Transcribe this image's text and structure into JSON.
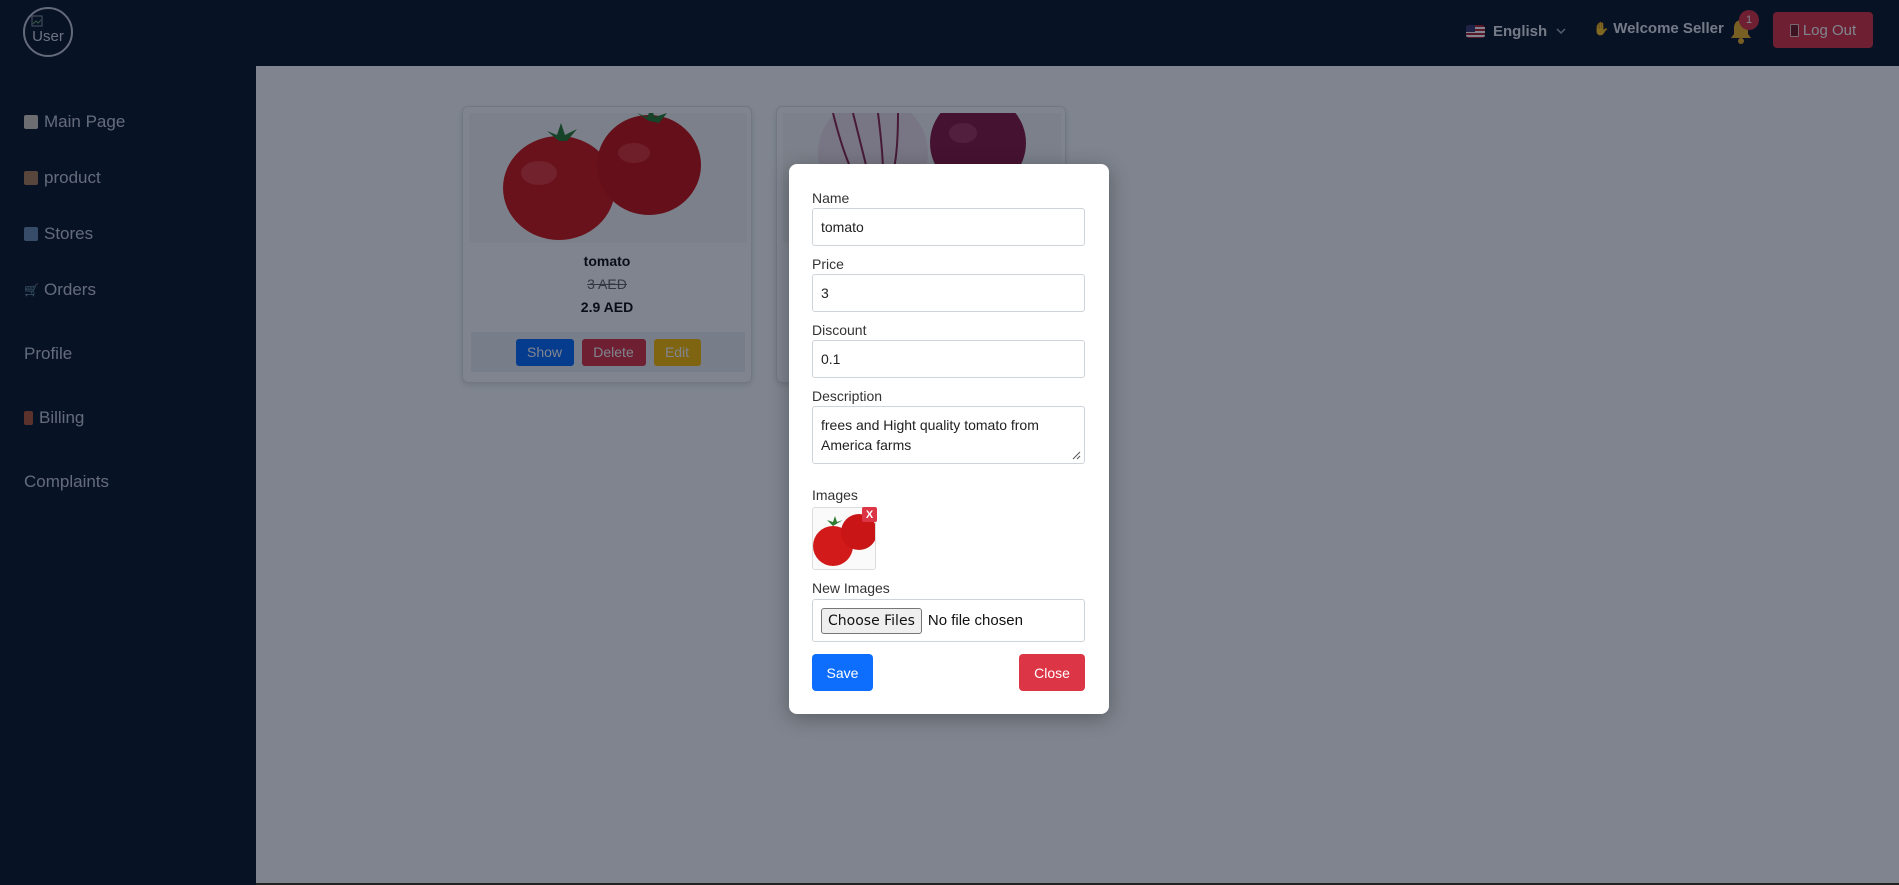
{
  "topbar": {
    "avatar_alt": "User",
    "language": "English",
    "welcome": "Welcome Seller",
    "notifications_count": "1",
    "logout_label": "Log Out",
    "icons": [
      "us-flag-icon",
      "chevron-down-icon",
      "waving-hand-icon",
      "bell-icon",
      "door-icon"
    ]
  },
  "sidebar": {
    "items": [
      {
        "label": "Main Page",
        "icon": "home-icon"
      },
      {
        "label": "product",
        "icon": "box-icon"
      },
      {
        "label": "Stores",
        "icon": "store-icon"
      },
      {
        "label": "Orders",
        "icon": "cart-icon"
      },
      {
        "label": "Profile",
        "icon": ""
      },
      {
        "label": "Billing",
        "icon": "receipt-icon"
      },
      {
        "label": "Complaints",
        "icon": ""
      }
    ]
  },
  "products": [
    {
      "name": "tomato",
      "old_price": "3 AED",
      "new_price": "2.9 AED",
      "actions": {
        "show": "Show",
        "delete": "Delete",
        "edit": "Edit"
      }
    },
    {
      "name": "",
      "image": "onion"
    }
  ],
  "modal": {
    "name_label": "Name",
    "name_value": "tomato",
    "price_label": "Price",
    "price_value": "3",
    "discount_label": "Discount",
    "discount_value": "0.1",
    "description_label": "Description",
    "description_value": "frees and Hight quality tomato from America farms",
    "images_label": "Images",
    "remove_image": "X",
    "new_images_label": "New Images",
    "choose_files": "Choose Files",
    "no_file": "No file chosen",
    "save_label": "Save",
    "close_label": "Close"
  },
  "colors": {
    "topbar_bg": "#111a2c",
    "primary": "#0d6efd",
    "danger": "#dc3545",
    "warning": "#ffc107"
  }
}
